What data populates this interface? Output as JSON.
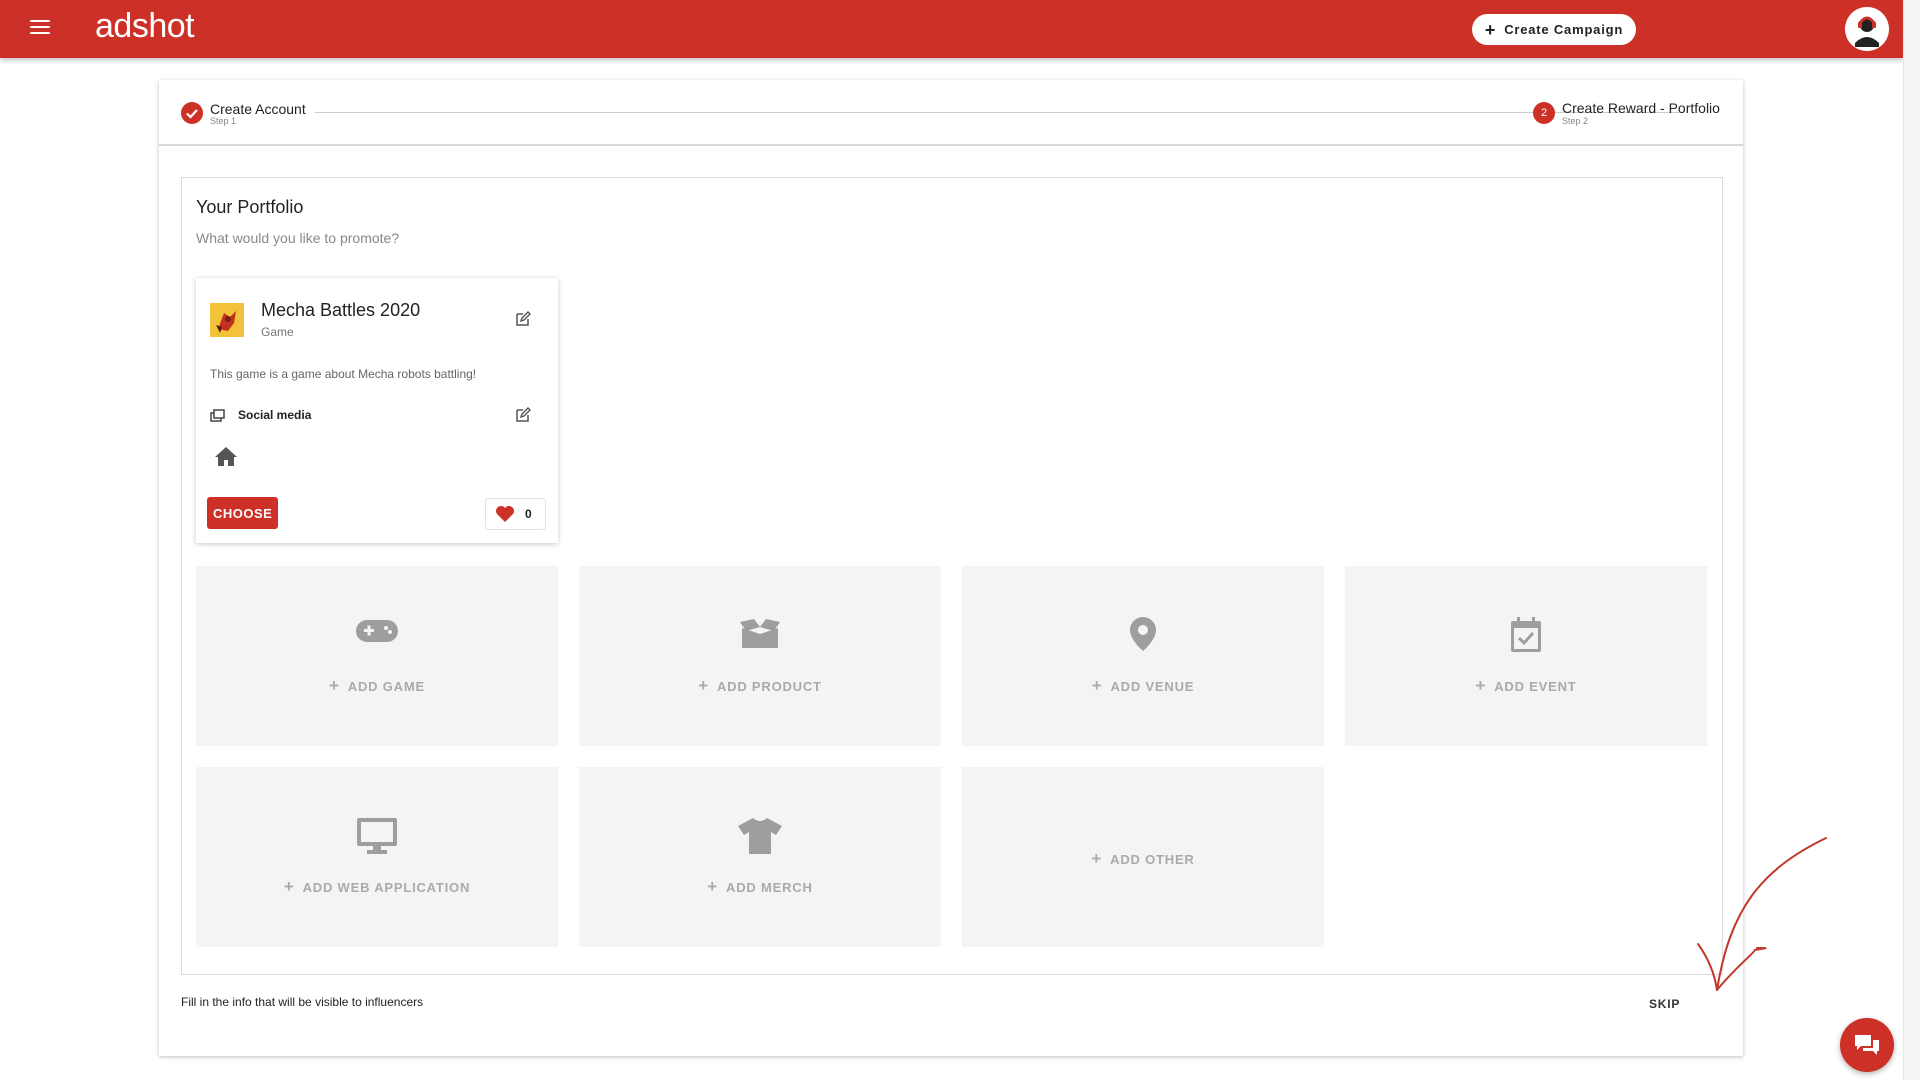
{
  "header": {
    "logo": "adshot",
    "create_campaign_label": "Create Campaign"
  },
  "stepper": {
    "step1": {
      "label": "Create Account",
      "sub": "Step 1"
    },
    "step2": {
      "number": "2",
      "label": "Create Reward - Portfolio",
      "sub": "Step 2"
    }
  },
  "portfolio": {
    "title": "Your Portfolio",
    "subtitle": "What would you like to promote?",
    "item": {
      "title": "Mecha Battles 2020",
      "type": "Game",
      "description": "This game is a game about Mecha robots battling!",
      "channel": "Social media",
      "choose_label": "CHOOSE",
      "likes": "0"
    },
    "tiles": [
      {
        "label": "ADD GAME",
        "icon": "gamepad-icon"
      },
      {
        "label": "ADD PRODUCT",
        "icon": "box-icon"
      },
      {
        "label": "ADD VENUE",
        "icon": "location-pin-icon"
      },
      {
        "label": "ADD EVENT",
        "icon": "calendar-check-icon"
      },
      {
        "label": "ADD WEB APPLICATION",
        "icon": "monitor-icon"
      },
      {
        "label": "ADD MERCH",
        "icon": "tshirt-icon"
      },
      {
        "label": "ADD OTHER",
        "icon": ""
      }
    ]
  },
  "footer": {
    "info": "Fill in the info that will be visible to influencers",
    "skip_label": "SKIP"
  },
  "colors": {
    "brand": "#cc3027",
    "tile_bg": "#f4f4f4",
    "tile_fg": "#aaaaaa"
  }
}
